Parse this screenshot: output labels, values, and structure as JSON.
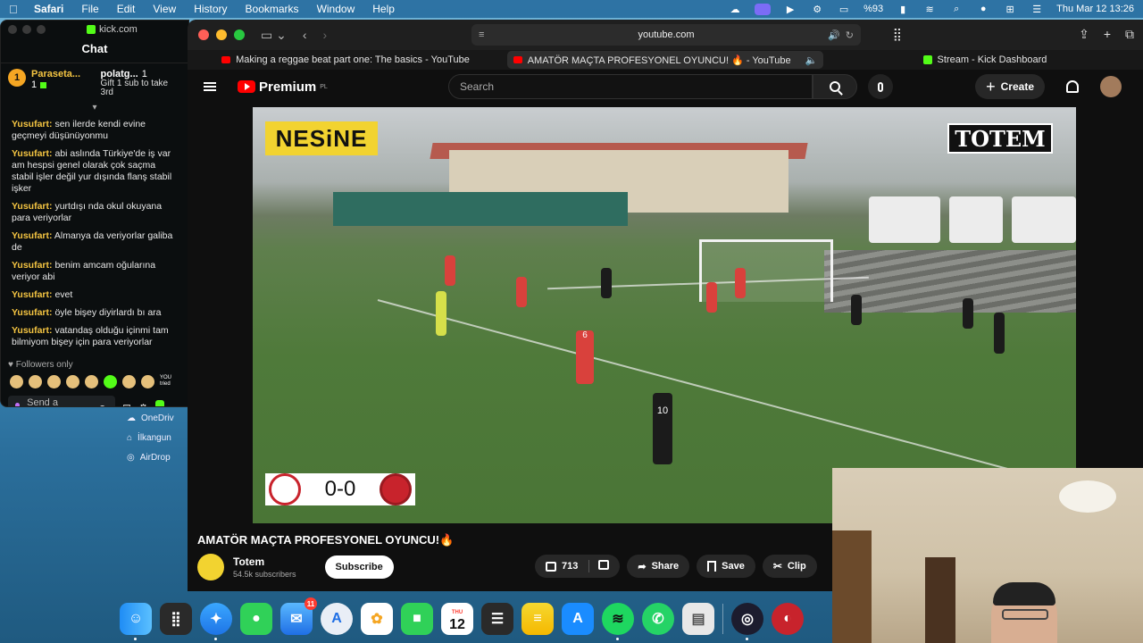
{
  "menubar": {
    "app": "Safari",
    "menus": [
      "File",
      "Edit",
      "View",
      "History",
      "Bookmarks",
      "Window",
      "Help"
    ],
    "battery": "%93",
    "clock": "Thu Mar 12  13:26"
  },
  "kick": {
    "site": "kick.com",
    "chat_title": "Chat",
    "top1_rank": "1",
    "top1_name": "Paraseta...",
    "top1_count": "1",
    "top2_name": "polatg...",
    "top2_count": "1",
    "top2_gift": "Gift 1 sub to take 3rd",
    "messages": [
      {
        "user": "Yusufart:",
        "text": "sen ilerde kendi evine geçmeyi düşünüyonmu"
      },
      {
        "user": "Yusufart:",
        "text": "abi aslında Türkiye'de iş var am hespsi genel olarak çok saçma stabil işler değil yur dışında flanş stabil işker"
      },
      {
        "user": "Yusufart:",
        "text": "yurtdışı nda okul okuyana para veriyorlar"
      },
      {
        "user": "Yusufart:",
        "text": "Almanya da veriyorlar galiba de"
      },
      {
        "user": "Yusufart:",
        "text": "benim amcam oğularına veriyor abi"
      },
      {
        "user": "Yusufart:",
        "text": "evet"
      },
      {
        "user": "Yusufart:",
        "text": "öyle bişey diyirlardı bı ara"
      },
      {
        "user": "Yusufart:",
        "text": "vatandaş olduğu içinmi tam bilmiyom bişey için para veriyorlar"
      }
    ],
    "followers_only": "Followers only",
    "emote_text": "YOU tried",
    "send_placeholder": "Send a message"
  },
  "finder": {
    "items": [
      "OneDriv",
      "İlkangun",
      "AirDrop"
    ]
  },
  "safari": {
    "address": "youtube.com",
    "tabs": [
      {
        "label": "Making a reggae beat part one: The basics - YouTube",
        "active": false
      },
      {
        "label": "AMATÖR MAÇTA PROFESYONEL OYUNCU! 🔥 - YouTube",
        "active": true
      },
      {
        "label": "Stream - Kick Dashboard",
        "active": false
      }
    ]
  },
  "youtube": {
    "logo": "Premium",
    "logo_region": "PL",
    "search_placeholder": "Search",
    "create_label": "Create",
    "video": {
      "sponsor": "NESiNE",
      "watermark": "TOTEM",
      "score": "0-0",
      "home_kit_number": "6",
      "away_kit_number": "10"
    },
    "title": "AMATÖR MAÇTA PROFESYONEL OYUNCU!🔥",
    "channel": "Totem",
    "subscribers": "54.5k subscribers",
    "subscribe_label": "Subscribe",
    "likes": "713",
    "share_label": "Share",
    "save_label": "Save",
    "clip_label": "Clip"
  },
  "dock": {
    "mail_badge": "11",
    "calendar_day": "12",
    "calendar_month": "THU"
  }
}
